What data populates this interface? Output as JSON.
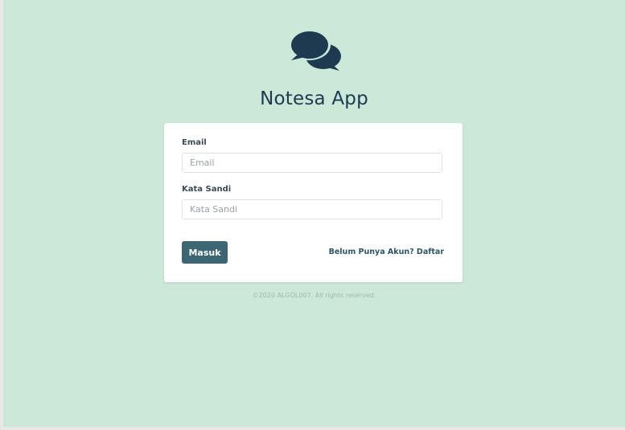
{
  "app": {
    "title": "Notesa App",
    "logo_icon": "chat-bubbles-icon"
  },
  "login_form": {
    "email_label": "Email",
    "email_placeholder": "Email",
    "email_value": "",
    "password_label": "Kata Sandi",
    "password_placeholder": "Kata Sandi",
    "password_value": "",
    "submit_label": "Masuk",
    "register_link": "Belum Punya Akun? Daftar"
  },
  "footer": {
    "copyright": "©2020 ALGOL007. All rights reserved."
  },
  "colors": {
    "background": "#cce8d8",
    "primary": "#3d6673",
    "title": "#1e3a50",
    "card": "#ffffff"
  }
}
